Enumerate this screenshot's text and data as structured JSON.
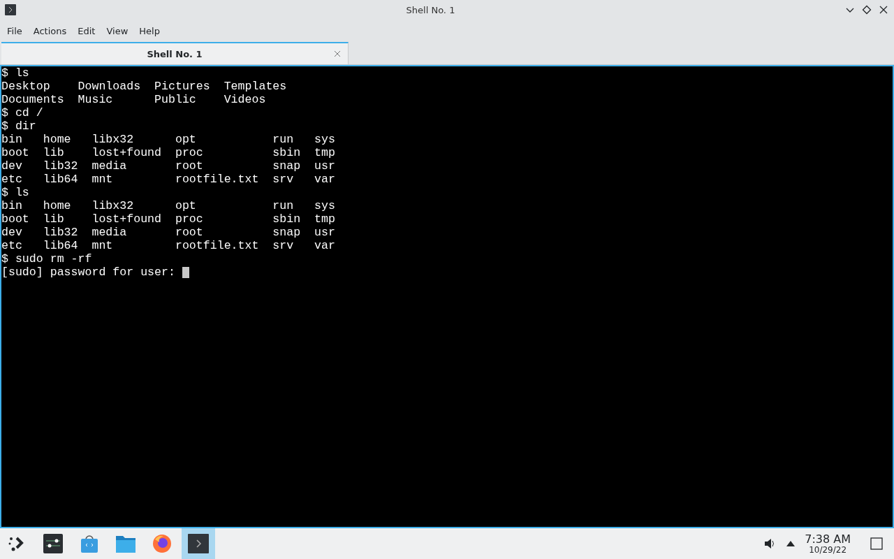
{
  "window": {
    "title": "Shell No. 1"
  },
  "menu": [
    "File",
    "Actions",
    "Edit",
    "View",
    "Help"
  ],
  "tabs": [
    {
      "label": "Shell No. 1",
      "selected": true
    }
  ],
  "terminal": {
    "lines": [
      "$ ls",
      "Desktop    Downloads  Pictures  Templates",
      "Documents  Music      Public    Videos",
      "$ cd /",
      "$ dir",
      "bin   home   libx32      opt           run   sys",
      "boot  lib    lost+found  proc          sbin  tmp",
      "dev   lib32  media       root          snap  usr",
      "etc   lib64  mnt         rootfile.txt  srv   var",
      "$ ls",
      "bin   home   libx32      opt           run   sys",
      "boot  lib    lost+found  proc          sbin  tmp",
      "dev   lib32  media       root          snap  usr",
      "etc   lib64  mnt         rootfile.txt  srv   var",
      "$ sudo rm -rf",
      "[sudo] password for user: "
    ],
    "cursor": true
  },
  "taskbar": {
    "items": [
      {
        "kind": "launcher",
        "selected": false
      },
      {
        "kind": "settings",
        "selected": false
      },
      {
        "kind": "store",
        "selected": false
      },
      {
        "kind": "files",
        "selected": false
      },
      {
        "kind": "browser",
        "selected": false
      },
      {
        "kind": "terminal",
        "selected": true
      }
    ],
    "clock": {
      "time": "7:38 AM",
      "date": "10/29/22"
    }
  }
}
